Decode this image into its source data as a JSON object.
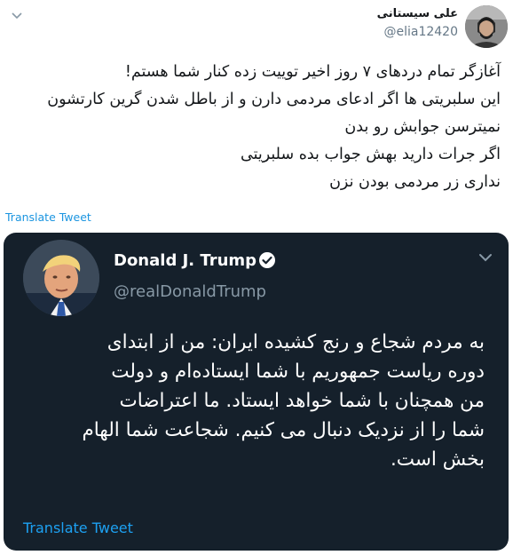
{
  "tweet": {
    "author_name": "علی سیستانی",
    "author_handle": "@elia12420",
    "text_lines": [
      "آغازگر تمام دردهای ۷ روز اخیر توییت زده کنار شما هستم!",
      "این سلبریتی ها اگر ادعای مردمی دارن و از باطل شدن گرین کارتشون",
      "نمیترسن جوابش رو بدن",
      "اگر جرات دارید بهش جواب بده سلبریتی",
      "نداری زر مردمی بودن نزن"
    ],
    "translate_label": "Translate Tweet",
    "menu_icon": "chevron-down-icon"
  },
  "quoted_tweet": {
    "author_name": "Donald J. Trump",
    "author_handle": "@realDonaldTrump",
    "verified_icon": "verified-badge-icon",
    "menu_icon": "chevron-down-icon",
    "text_lines": [
      "به مردم شجاع و رنج کشیده ایران: من از ابتدای",
      "دوره ریاست جمهوریم با شما ایستاده‌ام و دولت",
      "من همچنان با شما خواهد ایستاد. ما اعتراضات",
      "شما را از نزدیک دنبال می کنیم. شجاعت شما الهام",
      "بخش است."
    ],
    "translate_label": "Translate Tweet",
    "colors": {
      "background": "#15202b",
      "link": "#1da1f2",
      "secondary": "#8899a6"
    }
  }
}
